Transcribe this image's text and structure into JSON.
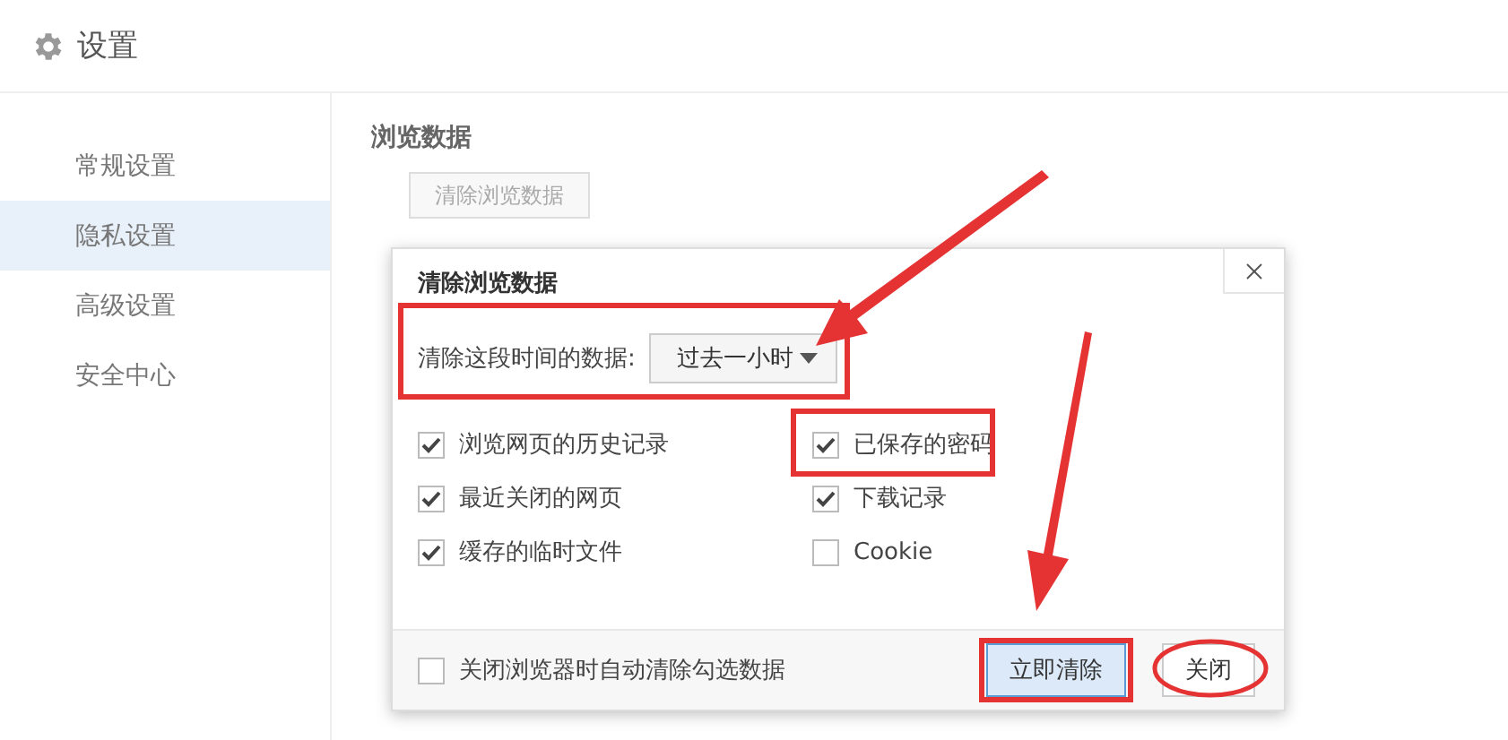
{
  "header": {
    "title": "设置"
  },
  "sidebar": {
    "items": [
      {
        "label": "常规设置",
        "selected": false
      },
      {
        "label": "隐私设置",
        "selected": true
      },
      {
        "label": "高级设置",
        "selected": false
      },
      {
        "label": "安全中心",
        "selected": false
      }
    ]
  },
  "content": {
    "section_title": "浏览数据",
    "clear_button": "清除浏览数据"
  },
  "dialog": {
    "title": "清除浏览数据",
    "time_range": {
      "label": "清除这段时间的数据:",
      "value": "过去一小时"
    },
    "options": [
      {
        "label": "浏览网页的历史记录",
        "checked": true
      },
      {
        "label": "已保存的密码",
        "checked": true
      },
      {
        "label": "最近关闭的网页",
        "checked": true
      },
      {
        "label": "下载记录",
        "checked": true
      },
      {
        "label": "缓存的临时文件",
        "checked": true
      },
      {
        "label": "Cookie",
        "checked": false
      }
    ],
    "auto_clear": {
      "label": "关闭浏览器时自动清除勾选数据",
      "checked": false
    },
    "buttons": [
      {
        "label": "立即清除",
        "kind": "primary"
      },
      {
        "label": "关闭",
        "kind": "secondary"
      }
    ]
  }
}
